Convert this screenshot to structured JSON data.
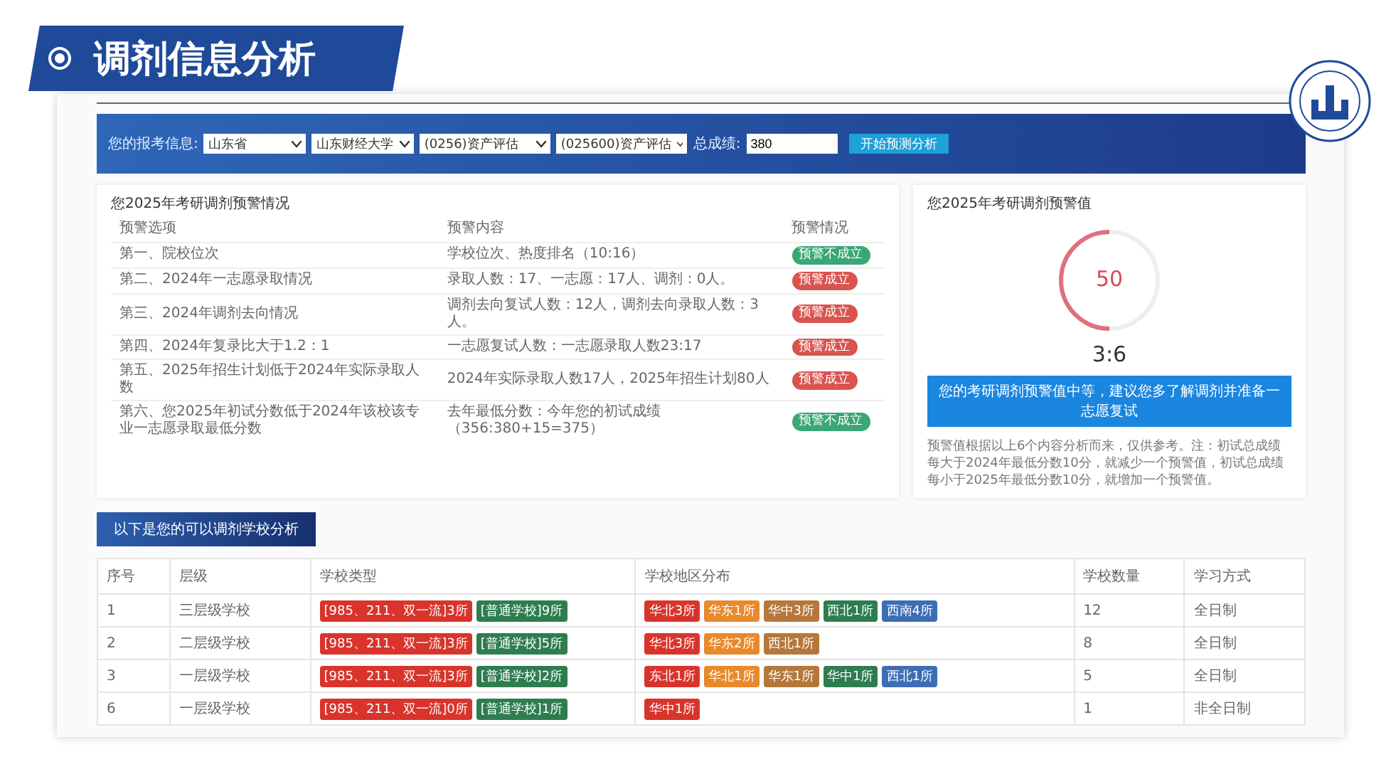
{
  "slide": {
    "title": "调剂信息分析"
  },
  "query_bar": {
    "label": "您的报考信息:",
    "selects": [
      "山东省",
      "山东财经大学",
      "(0256)资产评估",
      "(025600)资产评估"
    ],
    "score_label": "总成绩:",
    "score": "380",
    "button": "开始预测分析"
  },
  "warning_card": {
    "title": "您2025年考研调剂预警情况",
    "columns": [
      "预警选项",
      "预警内容",
      "预警情况"
    ],
    "rows": [
      {
        "option": "第一、院校位次",
        "content": "学校位次、热度排名（10:16）",
        "status": "预警不成立",
        "triggered": false
      },
      {
        "option": "第二、2024年一志愿录取情况",
        "content": "录取人数：17、一志愿：17人、调剂：0人。",
        "status": "预警成立",
        "triggered": true
      },
      {
        "option": "第三、2024年调剂去向情况",
        "content": "调剂去向复试人数：12人，调剂去向录取人数：3人。",
        "status": "预警成立",
        "triggered": true
      },
      {
        "option": "第四、2024年复录比大于1.2：1",
        "content": "一志愿复试人数：一志愿录取人数23:17",
        "status": "预警成立",
        "triggered": true
      },
      {
        "option": "第五、2025年招生计划低于2024年实际录取人数",
        "content": "2024年实际录取人数17人，2025年招生计划80人",
        "status": "预警成立",
        "triggered": true
      },
      {
        "option": "第六、您2025年初试分数低于2024年该校该专业一志愿录取最低分数",
        "content": "去年最低分数：今年您的初试成绩（356:380+15=375）",
        "status": "预警不成立",
        "triggered": false
      }
    ]
  },
  "gauge_card": {
    "title": "您2025年考研调剂预警值",
    "value": "50",
    "level": 0.5,
    "ratio": "3:6",
    "advice": "您的考研调剂预警值中等，建议您多了解调剂并准备一志愿复试",
    "note": "预警值根据以上6个内容分析而来，仅供参考。注：初试总成绩每大于2024年最低分数10分，就减少一个预警值，初试总成绩每小于2025年最低分数10分，就增加一个预警值。"
  },
  "schools": {
    "button": "以下是您的可以调剂学校分析",
    "columns": [
      "序号",
      "层级",
      "学校类型",
      "学校地区分布",
      "学校数量",
      "学习方式"
    ],
    "rows": [
      {
        "index": "1",
        "tier": "三层级学校",
        "types": [
          {
            "label": "[985、211、双一流]3所",
            "color": "#d9342b"
          },
          {
            "label": "[普通学校]9所",
            "color": "#2e7d4f"
          }
        ],
        "regions": [
          {
            "label": "华北3所",
            "color": "#d9342b"
          },
          {
            "label": "华东1所",
            "color": "#e8892a"
          },
          {
            "label": "华中3所",
            "color": "#b5773a"
          },
          {
            "label": "西北1所",
            "color": "#2e7d4f"
          },
          {
            "label": "西南4所",
            "color": "#3d6db5"
          }
        ],
        "count": "12",
        "mode": "全日制"
      },
      {
        "index": "2",
        "tier": "二层级学校",
        "types": [
          {
            "label": "[985、211、双一流]3所",
            "color": "#d9342b"
          },
          {
            "label": "[普通学校]5所",
            "color": "#2e7d4f"
          }
        ],
        "regions": [
          {
            "label": "华北3所",
            "color": "#d9342b"
          },
          {
            "label": "华东2所",
            "color": "#e8892a"
          },
          {
            "label": "西北1所",
            "color": "#b5773a"
          }
        ],
        "count": "8",
        "mode": "全日制"
      },
      {
        "index": "3",
        "tier": "一层级学校",
        "types": [
          {
            "label": "[985、211、双一流]3所",
            "color": "#d9342b"
          },
          {
            "label": "[普通学校]2所",
            "color": "#2e7d4f"
          }
        ],
        "regions": [
          {
            "label": "东北1所",
            "color": "#d9342b"
          },
          {
            "label": "华北1所",
            "color": "#e8892a"
          },
          {
            "label": "华东1所",
            "color": "#b5773a"
          },
          {
            "label": "华中1所",
            "color": "#2e7d4f"
          },
          {
            "label": "西北1所",
            "color": "#3d6db5"
          }
        ],
        "count": "5",
        "mode": "全日制"
      },
      {
        "index": "6",
        "tier": "一层级学校",
        "types": [
          {
            "label": "[985、211、双一流]0所",
            "color": "#d9342b"
          },
          {
            "label": "[普通学校]1所",
            "color": "#2e7d4f"
          }
        ],
        "regions": [
          {
            "label": "华中1所",
            "color": "#d9342b"
          }
        ],
        "count": "1",
        "mode": "非全日制"
      }
    ]
  }
}
